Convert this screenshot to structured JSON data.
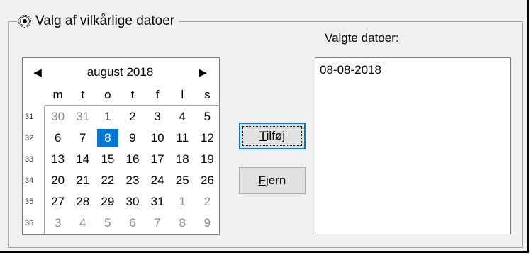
{
  "group": {
    "title": "Valg af vilkårlige datoer",
    "radio_selected": true
  },
  "calendar": {
    "month_label": "august 2018",
    "prev_icon": "triangle-left",
    "next_icon": "triangle-right",
    "weekdays": [
      "m",
      "t",
      "o",
      "t",
      "f",
      "l",
      "s"
    ],
    "weeks": [
      {
        "num": "31",
        "days": [
          {
            "d": "30",
            "o": true
          },
          {
            "d": "31",
            "o": true
          },
          {
            "d": "1"
          },
          {
            "d": "2"
          },
          {
            "d": "3"
          },
          {
            "d": "4"
          },
          {
            "d": "5"
          }
        ]
      },
      {
        "num": "32",
        "days": [
          {
            "d": "6"
          },
          {
            "d": "7"
          },
          {
            "d": "8",
            "s": true
          },
          {
            "d": "9"
          },
          {
            "d": "10"
          },
          {
            "d": "11"
          },
          {
            "d": "12"
          }
        ]
      },
      {
        "num": "33",
        "days": [
          {
            "d": "13"
          },
          {
            "d": "14"
          },
          {
            "d": "15"
          },
          {
            "d": "16"
          },
          {
            "d": "17"
          },
          {
            "d": "18"
          },
          {
            "d": "19"
          }
        ]
      },
      {
        "num": "34",
        "days": [
          {
            "d": "20"
          },
          {
            "d": "21"
          },
          {
            "d": "22"
          },
          {
            "d": "23"
          },
          {
            "d": "24"
          },
          {
            "d": "25"
          },
          {
            "d": "26"
          }
        ]
      },
      {
        "num": "35",
        "days": [
          {
            "d": "27"
          },
          {
            "d": "28"
          },
          {
            "d": "29"
          },
          {
            "d": "30"
          },
          {
            "d": "31"
          },
          {
            "d": "1",
            "o": true
          },
          {
            "d": "2",
            "o": true
          }
        ]
      },
      {
        "num": "36",
        "days": [
          {
            "d": "3",
            "o": true
          },
          {
            "d": "4",
            "o": true
          },
          {
            "d": "5",
            "o": true
          },
          {
            "d": "6",
            "o": true
          },
          {
            "d": "7",
            "o": true
          },
          {
            "d": "8",
            "o": true
          },
          {
            "d": "9",
            "o": true
          }
        ]
      }
    ],
    "selected_color": "#0078d7"
  },
  "buttons": {
    "add": {
      "accel": "T",
      "rest": "ilføj"
    },
    "remove": {
      "accel": "F",
      "rest": "jern"
    }
  },
  "selected_dates": {
    "label": "Valgte datoer:",
    "items": [
      "08-08-2018"
    ]
  }
}
